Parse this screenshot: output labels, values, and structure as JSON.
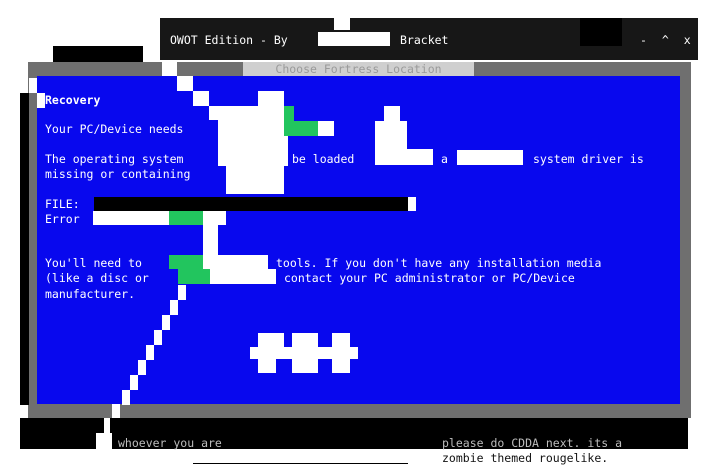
{
  "window": {
    "title_prefix": "OWOT Edition - By",
    "title_suffix": "Bracket",
    "controls": "- ^ x"
  },
  "subtitle": "Choose Fortress Location",
  "screen": {
    "heading": "Recovery",
    "line1": "Your PC/Device needs",
    "line2a": "The operating system",
    "line2b": "be loaded",
    "line2c": "a",
    "line2d": "system driver is",
    "line3": "missing or containing",
    "file_label": "FILE:",
    "error_label": "Error",
    "line4a": "You'll need to",
    "line4b": "tools. If you don't have any installation media",
    "line5a": "(like a disc or",
    "line5b": "contact your PC administrator or PC/Device",
    "line6": "manufacturer."
  },
  "footer": {
    "left": "whoever you are",
    "right_line1": "please do CDDA next. its a",
    "right_line2": "zombie themed rougelike."
  }
}
